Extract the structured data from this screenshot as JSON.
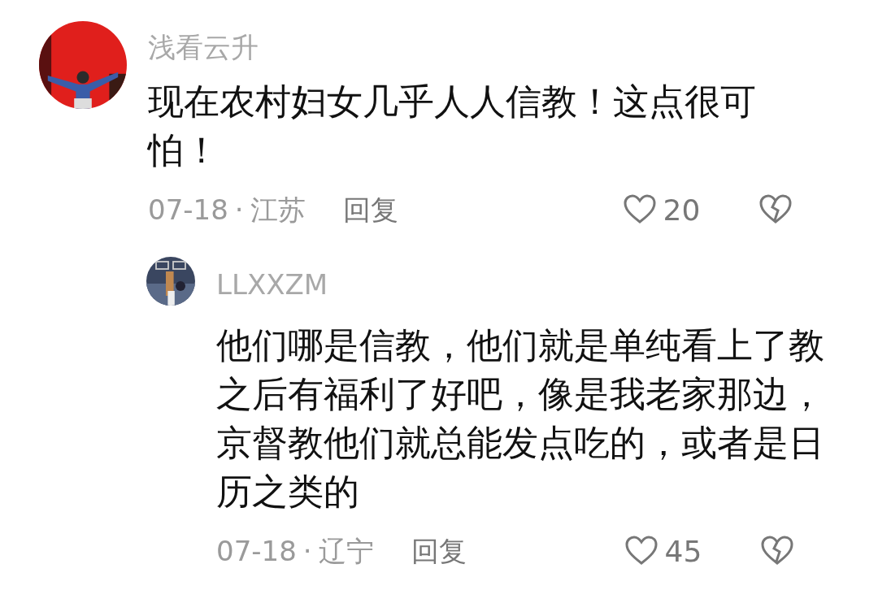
{
  "comments": [
    {
      "author": "浅看云升",
      "text": "现在农村妇女几乎人人信教！这点很可怕！",
      "date": "07-18",
      "separator": "·",
      "location": "江苏",
      "reply_label": "回复",
      "likes": "20",
      "replies": [
        {
          "author": "LLXXZM",
          "text": "他们哪是信教，他们就是单纯看上了教之后有福利了好吧，像是我老家那边，京督教他们就总能发点吃的，或者是日历之类的",
          "date": "07-18",
          "separator": "·",
          "location": "辽宁",
          "reply_label": "回复",
          "likes": "45"
        }
      ]
    }
  ]
}
